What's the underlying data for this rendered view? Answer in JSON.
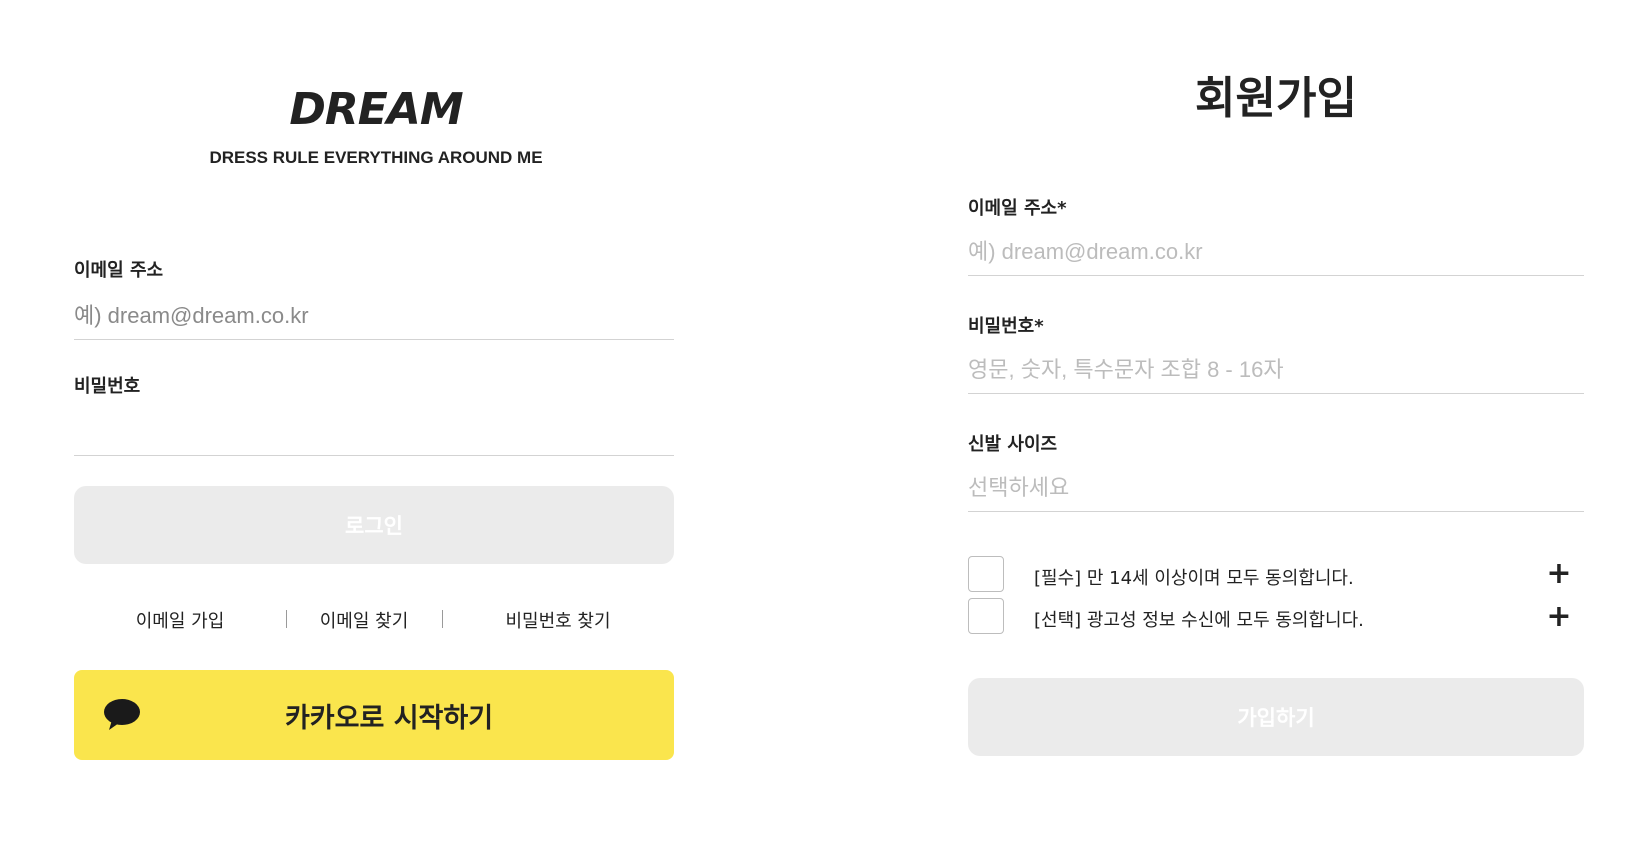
{
  "login": {
    "logo": "DREAM",
    "tagline": "DRESS RULE EVERYTHING AROUND ME",
    "email_label": "이메일 주소",
    "email_placeholder": "예) dream@dream.co.kr",
    "email_value": "",
    "password_label": "비밀번호",
    "password_value": "",
    "login_button": "로그인",
    "links": {
      "email_signup": "이메일 가입",
      "find_email": "이메일 찾기",
      "find_password": "비밀번호 찾기"
    },
    "kakao_button": "카카오로 시작하기"
  },
  "signup": {
    "title": "회원가입",
    "email_label": "이메일 주소*",
    "email_placeholder": "예) dream@dream.co.kr",
    "password_label": "비밀번호*",
    "password_placeholder": "영문, 숫자, 특수문자 조합 8 - 16자",
    "shoe_size_label": "신발 사이즈",
    "shoe_size_placeholder": "선택하세요",
    "agreements": [
      {
        "text": "[필수] 만 14세 이상이며 모두 동의합니다.",
        "checked": false
      },
      {
        "text": "[선택] 광고성 정보 수신에 모두 동의합니다.",
        "checked": false
      }
    ],
    "signup_button": "가입하기"
  },
  "colors": {
    "kakao_yellow": "#fae54d",
    "disabled_button": "#ebebeb",
    "divider": "#d3d3d3"
  }
}
